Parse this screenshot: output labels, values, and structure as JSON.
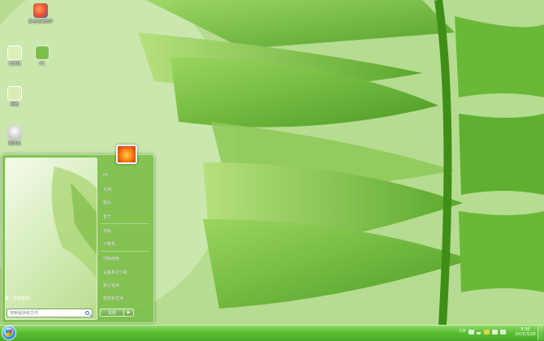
{
  "desktop": {
    "icons": [
      {
        "label": "安全管家软件",
        "icon": "app-icon",
        "color": "#e74c3c"
      },
      {
        "label": "计算机",
        "icon": "computer-icon",
        "color": "#cfe6a0"
      },
      {
        "label": "PC",
        "icon": "pc-icon",
        "color": "#7cc04a"
      },
      {
        "label": "网络",
        "icon": "network-icon",
        "color": "#d9ecb2"
      },
      {
        "label": "回收站",
        "icon": "recycle-bin-icon",
        "color": "#eaeaea"
      }
    ]
  },
  "start_menu": {
    "all_programs": "所有程序",
    "search_placeholder": "搜索程序和文件",
    "right_items": [
      "PC",
      "文档",
      "图片",
      "音乐",
      "游戏",
      "计算机",
      "控制面板",
      "设备和打印机",
      "默认程序",
      "帮助和支持"
    ],
    "shutdown_label": "关机",
    "shutdown_arrow": "▶"
  },
  "taskbar": {
    "lang": "CH",
    "clock_time": "9:30",
    "clock_date": "2015/3/28",
    "accent": "#5bbf35"
  }
}
